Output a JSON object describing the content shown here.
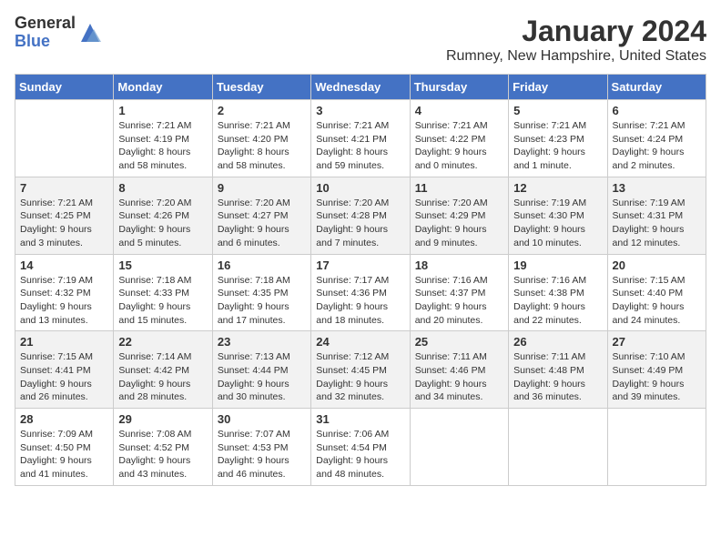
{
  "logo": {
    "general": "General",
    "blue": "Blue"
  },
  "title": {
    "month": "January 2024",
    "location": "Rumney, New Hampshire, United States"
  },
  "weekdays": [
    "Sunday",
    "Monday",
    "Tuesday",
    "Wednesday",
    "Thursday",
    "Friday",
    "Saturday"
  ],
  "weeks": [
    [
      {
        "day": "",
        "info": ""
      },
      {
        "day": "1",
        "info": "Sunrise: 7:21 AM\nSunset: 4:19 PM\nDaylight: 8 hours\nand 58 minutes."
      },
      {
        "day": "2",
        "info": "Sunrise: 7:21 AM\nSunset: 4:20 PM\nDaylight: 8 hours\nand 58 minutes."
      },
      {
        "day": "3",
        "info": "Sunrise: 7:21 AM\nSunset: 4:21 PM\nDaylight: 8 hours\nand 59 minutes."
      },
      {
        "day": "4",
        "info": "Sunrise: 7:21 AM\nSunset: 4:22 PM\nDaylight: 9 hours\nand 0 minutes."
      },
      {
        "day": "5",
        "info": "Sunrise: 7:21 AM\nSunset: 4:23 PM\nDaylight: 9 hours\nand 1 minute."
      },
      {
        "day": "6",
        "info": "Sunrise: 7:21 AM\nSunset: 4:24 PM\nDaylight: 9 hours\nand 2 minutes."
      }
    ],
    [
      {
        "day": "7",
        "info": "Sunrise: 7:21 AM\nSunset: 4:25 PM\nDaylight: 9 hours\nand 3 minutes."
      },
      {
        "day": "8",
        "info": "Sunrise: 7:20 AM\nSunset: 4:26 PM\nDaylight: 9 hours\nand 5 minutes."
      },
      {
        "day": "9",
        "info": "Sunrise: 7:20 AM\nSunset: 4:27 PM\nDaylight: 9 hours\nand 6 minutes."
      },
      {
        "day": "10",
        "info": "Sunrise: 7:20 AM\nSunset: 4:28 PM\nDaylight: 9 hours\nand 7 minutes."
      },
      {
        "day": "11",
        "info": "Sunrise: 7:20 AM\nSunset: 4:29 PM\nDaylight: 9 hours\nand 9 minutes."
      },
      {
        "day": "12",
        "info": "Sunrise: 7:19 AM\nSunset: 4:30 PM\nDaylight: 9 hours\nand 10 minutes."
      },
      {
        "day": "13",
        "info": "Sunrise: 7:19 AM\nSunset: 4:31 PM\nDaylight: 9 hours\nand 12 minutes."
      }
    ],
    [
      {
        "day": "14",
        "info": "Sunrise: 7:19 AM\nSunset: 4:32 PM\nDaylight: 9 hours\nand 13 minutes."
      },
      {
        "day": "15",
        "info": "Sunrise: 7:18 AM\nSunset: 4:33 PM\nDaylight: 9 hours\nand 15 minutes."
      },
      {
        "day": "16",
        "info": "Sunrise: 7:18 AM\nSunset: 4:35 PM\nDaylight: 9 hours\nand 17 minutes."
      },
      {
        "day": "17",
        "info": "Sunrise: 7:17 AM\nSunset: 4:36 PM\nDaylight: 9 hours\nand 18 minutes."
      },
      {
        "day": "18",
        "info": "Sunrise: 7:16 AM\nSunset: 4:37 PM\nDaylight: 9 hours\nand 20 minutes."
      },
      {
        "day": "19",
        "info": "Sunrise: 7:16 AM\nSunset: 4:38 PM\nDaylight: 9 hours\nand 22 minutes."
      },
      {
        "day": "20",
        "info": "Sunrise: 7:15 AM\nSunset: 4:40 PM\nDaylight: 9 hours\nand 24 minutes."
      }
    ],
    [
      {
        "day": "21",
        "info": "Sunrise: 7:15 AM\nSunset: 4:41 PM\nDaylight: 9 hours\nand 26 minutes."
      },
      {
        "day": "22",
        "info": "Sunrise: 7:14 AM\nSunset: 4:42 PM\nDaylight: 9 hours\nand 28 minutes."
      },
      {
        "day": "23",
        "info": "Sunrise: 7:13 AM\nSunset: 4:44 PM\nDaylight: 9 hours\nand 30 minutes."
      },
      {
        "day": "24",
        "info": "Sunrise: 7:12 AM\nSunset: 4:45 PM\nDaylight: 9 hours\nand 32 minutes."
      },
      {
        "day": "25",
        "info": "Sunrise: 7:11 AM\nSunset: 4:46 PM\nDaylight: 9 hours\nand 34 minutes."
      },
      {
        "day": "26",
        "info": "Sunrise: 7:11 AM\nSunset: 4:48 PM\nDaylight: 9 hours\nand 36 minutes."
      },
      {
        "day": "27",
        "info": "Sunrise: 7:10 AM\nSunset: 4:49 PM\nDaylight: 9 hours\nand 39 minutes."
      }
    ],
    [
      {
        "day": "28",
        "info": "Sunrise: 7:09 AM\nSunset: 4:50 PM\nDaylight: 9 hours\nand 41 minutes."
      },
      {
        "day": "29",
        "info": "Sunrise: 7:08 AM\nSunset: 4:52 PM\nDaylight: 9 hours\nand 43 minutes."
      },
      {
        "day": "30",
        "info": "Sunrise: 7:07 AM\nSunset: 4:53 PM\nDaylight: 9 hours\nand 46 minutes."
      },
      {
        "day": "31",
        "info": "Sunrise: 7:06 AM\nSunset: 4:54 PM\nDaylight: 9 hours\nand 48 minutes."
      },
      {
        "day": "",
        "info": ""
      },
      {
        "day": "",
        "info": ""
      },
      {
        "day": "",
        "info": ""
      }
    ]
  ]
}
